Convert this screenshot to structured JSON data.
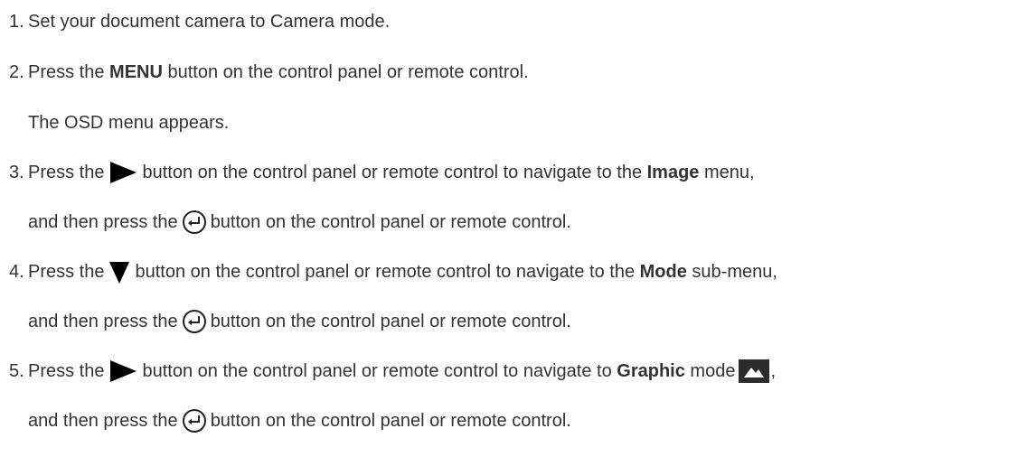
{
  "steps": [
    {
      "number": "1.",
      "text": "Set your document camera to Camera mode."
    },
    {
      "number": "2.",
      "pre": "Press the",
      "bold": "MENU",
      "post": "button on the control panel or remote control.",
      "note": "The OSD menu appears."
    },
    {
      "number": "3.",
      "pre": "Press the",
      "icon": "right-triangle-icon",
      "mid": "button on the control panel or remote control to navigate to the",
      "bold": "Image",
      "post": "menu,",
      "line2_pre": "and then press the",
      "line2_icon": "enter-icon",
      "line2_post": "button on the control panel or remote control."
    },
    {
      "number": "4.",
      "pre": "Press the",
      "icon": "down-triangle-icon",
      "mid": "button on the control panel or remote control to navigate to the",
      "bold": "Mode",
      "post": "sub-menu,",
      "line2_pre": "and then press the",
      "line2_icon": "enter-icon",
      "line2_post": "button on the control panel or remote control."
    },
    {
      "number": "5.",
      "pre": "Press the",
      "icon": "right-triangle-icon",
      "mid": "button on the control panel or remote control to navigate to",
      "bold": "Graphic",
      "post": "mode",
      "trail_icon": "graphic-mode-icon",
      "trail": ",",
      "line2_pre": "and then press the",
      "line2_icon": "enter-icon",
      "line2_post": "button on the control panel or remote control."
    }
  ]
}
